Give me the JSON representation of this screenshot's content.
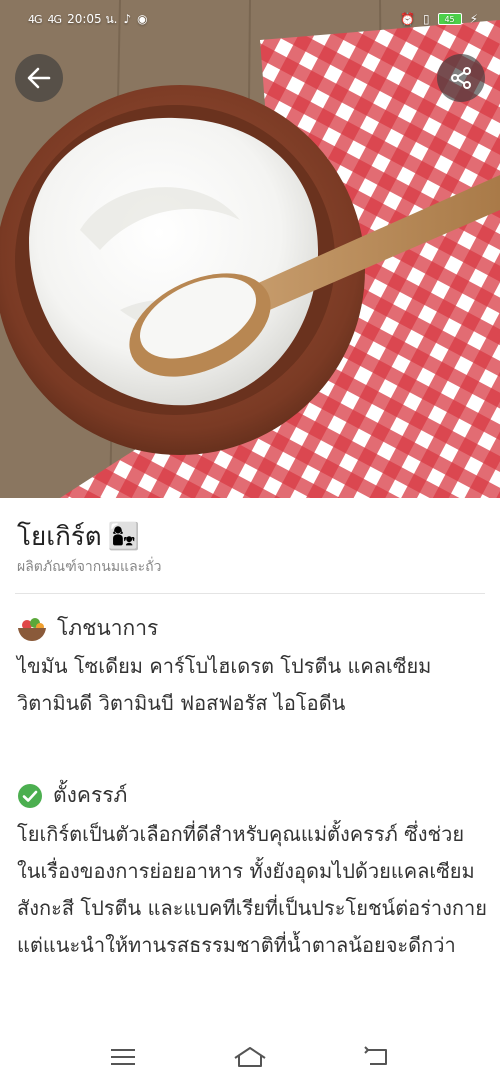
{
  "status_bar": {
    "signal_1": "4G",
    "signal_2": "4G",
    "time": "20:05 น.",
    "battery": "45",
    "icons": [
      "tiktok-icon",
      "messenger-icon",
      "alarm-icon",
      "vibrate-icon",
      "charging-icon"
    ]
  },
  "header": {
    "back_icon": "arrow-left-icon",
    "share_icon": "share-icon"
  },
  "food": {
    "title": "โยเกิร์ต",
    "emoji": "👩‍👧",
    "category": "ผลิตภัณฑ์จากนมและถั่ว"
  },
  "nutrition": {
    "heading": "โภชนาการ",
    "icon": "salad-bowl-icon",
    "text": "ไขมัน โซเดียม คาร์โบไฮเดรต โปรตีน แคลเซียม วิตามินดี วิตามินบี ฟอสฟอรัส ไอโอดีน"
  },
  "pregnancy": {
    "heading": "ตั้งครรภ์",
    "icon": "check-circle-icon",
    "status_color": "#4caf50",
    "text": "โยเกิร์ตเป็นตัวเลือกที่ดีสำหรับคุณแม่ตั้งครรภ์ ซึ่งช่วยในเรื่องของการย่อยอาหาร ทั้งยังอุดมไปด้วยแคลเซียม สังกะสี โปรตีน และแบคทีเรียที่เป็นประโยชน์ต่อร่างกาย แต่แนะนำให้ทานรสธรรมชาติที่น้ำตาลน้อยจะดีกว่า"
  },
  "nav_bar": {
    "icons": [
      "menu-icon",
      "home-icon",
      "back-nav-icon"
    ]
  }
}
